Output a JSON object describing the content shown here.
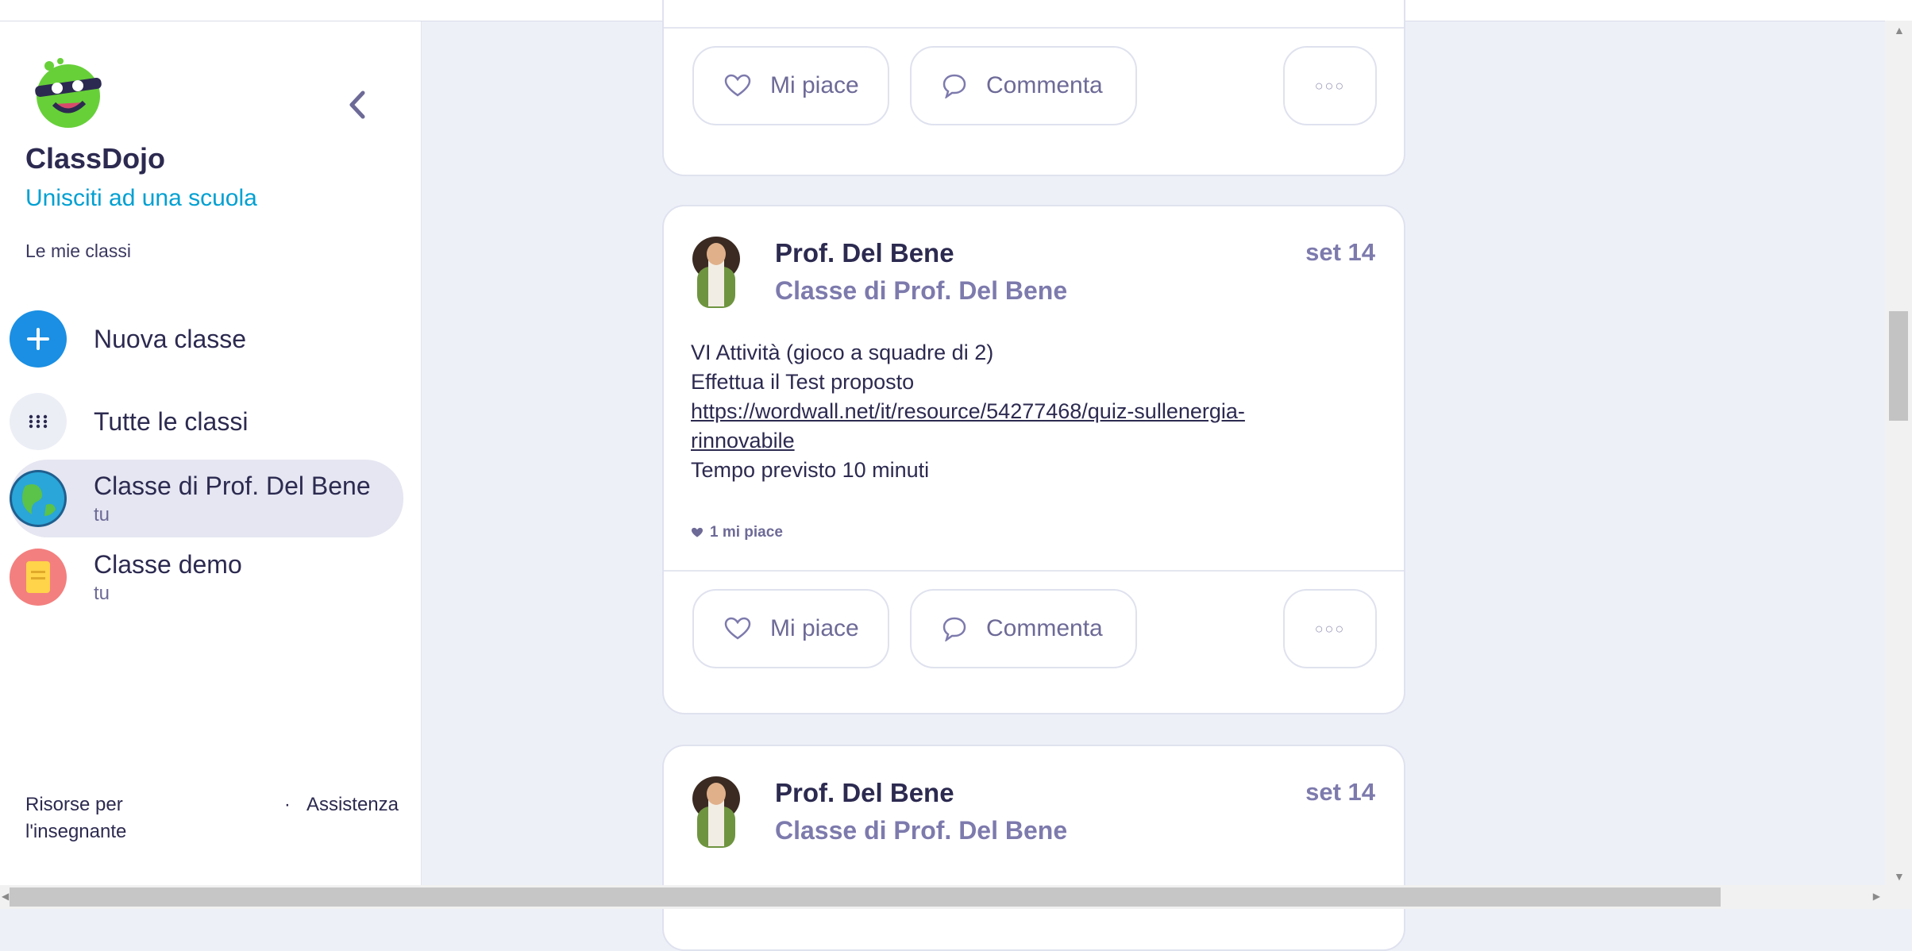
{
  "sidebar": {
    "brand": "ClassDojo",
    "join_school": "Unisciti ad una scuola",
    "my_classes": "Le mie classi",
    "items": [
      {
        "label": "Nuova classe",
        "sub": ""
      },
      {
        "label": "Tutte le classi",
        "sub": ""
      },
      {
        "label": "Classe di Prof. Del Bene",
        "sub": "tu"
      },
      {
        "label": "Classe demo",
        "sub": "tu"
      }
    ],
    "footer": {
      "resources": "Risorse per l'insegnante",
      "separator": "·",
      "help": "Assistenza"
    }
  },
  "actions": {
    "like": "Mi piace",
    "comment": "Commenta"
  },
  "posts": [
    {
      "author": "Prof. Del Bene",
      "class_name": "Classe di Prof. Del Bene",
      "date": "set 14",
      "line1": "VI Attività (gioco a squadre di 2)",
      "line2": "Effettua il Test proposto",
      "link": "https://wordwall.net/it/resource/54277468/quiz-sullenergia-rinnovabile",
      "line3": "Tempo previsto 10 minuti",
      "likes": "1 mi piace"
    },
    {
      "author": "Prof. Del Bene",
      "class_name": "Classe di Prof. Del Bene",
      "date": "set 14"
    }
  ],
  "colors": {
    "accent": "#00a0d2",
    "background": "#eef0f8",
    "text": "#2c2a50",
    "muted": "#7d7aad"
  }
}
